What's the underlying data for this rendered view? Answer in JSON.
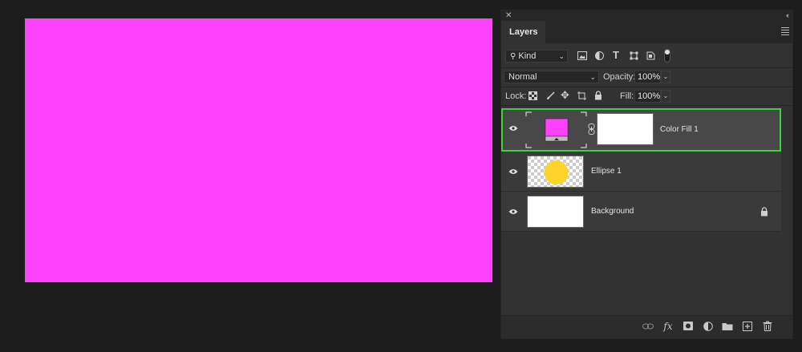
{
  "canvas": {
    "fill_color": "#fd41fd"
  },
  "panel": {
    "tab_label": "Layers",
    "filter": {
      "kind_label": "Kind"
    },
    "blend": {
      "mode": "Normal",
      "opacity_label": "Opacity:",
      "opacity_value": "100%"
    },
    "lock": {
      "lock_label": "Lock:",
      "fill_label": "Fill:",
      "fill_value": "100%"
    },
    "layers": [
      {
        "name": "Color Fill 1",
        "selected": true,
        "fill_color": "#fd41fd",
        "selection_color": "#3ad43a"
      },
      {
        "name": "Ellipse 1",
        "selected": false,
        "shape_color": "#ffd42a"
      },
      {
        "name": "Background",
        "selected": false,
        "locked": true
      }
    ],
    "bottom_icons": [
      "link-icon",
      "fx-icon",
      "mask-icon",
      "adjustment-icon",
      "folder-icon",
      "new-layer-icon",
      "trash-icon"
    ]
  }
}
